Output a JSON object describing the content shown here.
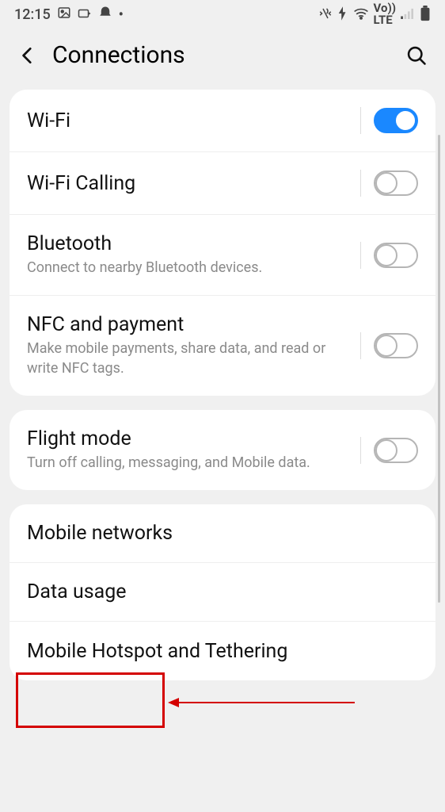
{
  "status": {
    "time": "12:15",
    "lte": "Vo))\nLTE"
  },
  "header": {
    "title": "Connections"
  },
  "groups": [
    {
      "rows": [
        {
          "title": "Wi-Fi",
          "sub": "",
          "toggle": true,
          "on": true
        },
        {
          "title": "Wi-Fi Calling",
          "sub": "",
          "toggle": true,
          "on": false
        },
        {
          "title": "Bluetooth",
          "sub": "Connect to nearby Bluetooth devices.",
          "toggle": true,
          "on": false
        },
        {
          "title": "NFC and payment",
          "sub": "Make mobile payments, share data, and read or write NFC tags.",
          "toggle": true,
          "on": false
        }
      ]
    },
    {
      "rows": [
        {
          "title": "Flight mode",
          "sub": "Turn off calling, messaging, and Mobile data.",
          "toggle": true,
          "on": false
        }
      ]
    },
    {
      "rows": [
        {
          "title": "Mobile networks",
          "sub": "",
          "toggle": false
        },
        {
          "title": "Data usage",
          "sub": "",
          "toggle": false
        },
        {
          "title": "Mobile Hotspot and Tethering",
          "sub": "",
          "toggle": false
        }
      ]
    }
  ]
}
